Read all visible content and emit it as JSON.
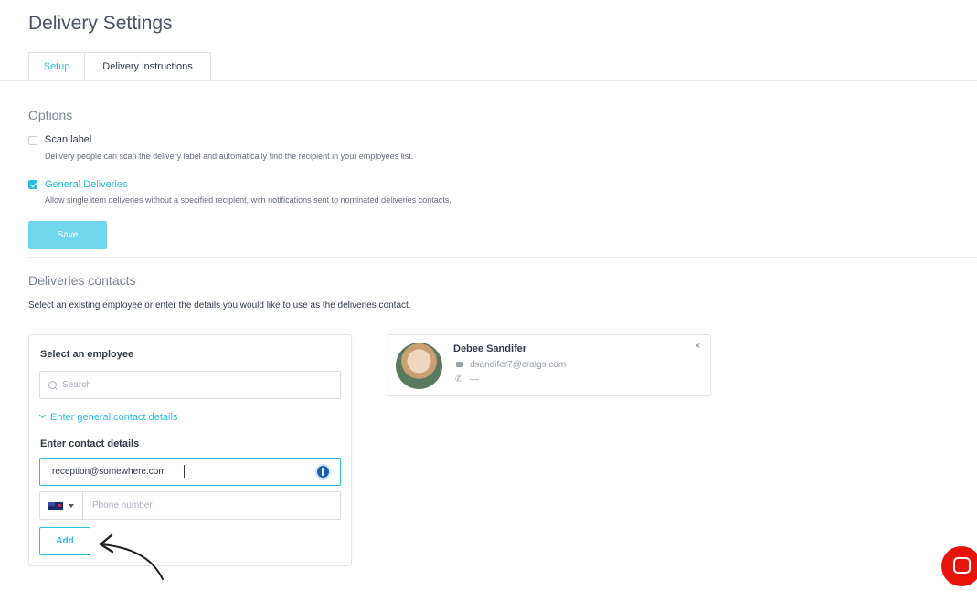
{
  "page": {
    "title": "Delivery Settings"
  },
  "tabs": [
    {
      "label": "Setup",
      "active": true
    },
    {
      "label": "Delivery instructions",
      "active": false
    }
  ],
  "options": {
    "title": "Options",
    "items": [
      {
        "label": "Scan label",
        "checked": false,
        "description": "Delivery people can scan the delivery label and automatically find the recipient in your employees list."
      },
      {
        "label": "General Deliveries",
        "checked": true,
        "description": "Allow single item deliveries without a specified recipient, with notifications sent to nominated deliveries contacts."
      }
    ],
    "save_label": "Save"
  },
  "contacts": {
    "title": "Deliveries contacts",
    "description": "Select an existing employee or enter the details you would like to use as the deliveries contact.",
    "panel": {
      "select_heading": "Select an employee",
      "search_placeholder": "Search",
      "toggle_label": "Enter general contact details",
      "enter_heading": "Enter contact details",
      "email_value": "reception@somewhere.com",
      "phone_placeholder": "Phone number",
      "add_label": "Add"
    },
    "card": {
      "name": "Debee Sandifer",
      "email": "dsandifer7@craigs.com",
      "phone": "—",
      "close_glyph": "×"
    }
  },
  "colors": {
    "accent": "#28bfe0",
    "save_disabled": "#6fd6ec",
    "chat": "#e8140c"
  },
  "icons": [
    "search-icon",
    "chevron-down-icon",
    "password-manager-icon",
    "flag-icon",
    "mail-icon",
    "phone-icon",
    "close-icon",
    "chat-icon",
    "checkmark-icon"
  ]
}
